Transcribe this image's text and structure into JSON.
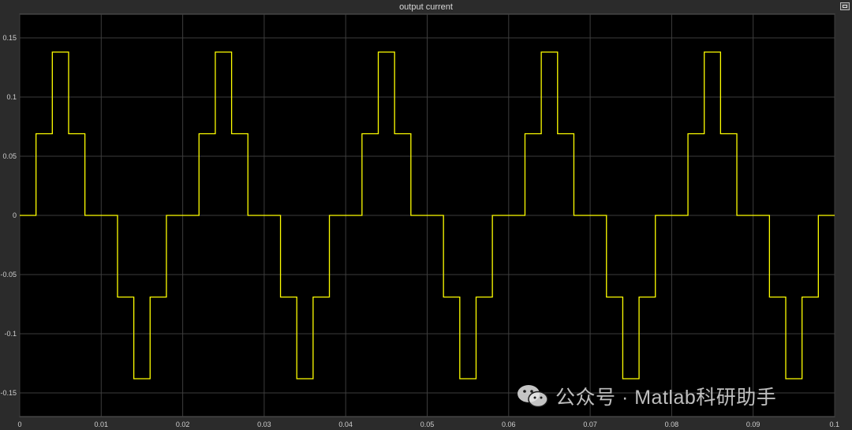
{
  "chart_data": {
    "type": "line",
    "title": "output current",
    "xlim": [
      0,
      0.1
    ],
    "ylim": [
      -0.17,
      0.17
    ],
    "x_ticks": [
      0,
      0.01,
      0.02,
      0.03,
      0.04,
      0.05,
      0.06,
      0.07,
      0.08,
      0.09,
      0.1
    ],
    "x_tick_labels": [
      "0",
      "0.01",
      "0.02",
      "0.03",
      "0.04",
      "0.05",
      "0.06",
      "0.07",
      "0.08",
      "0.09",
      "0.1"
    ],
    "y_ticks": [
      -0.15,
      -0.1,
      -0.05,
      0,
      0.05,
      0.1,
      0.15
    ],
    "y_tick_labels": [
      "-0.15",
      "-0.1",
      "-0.05",
      "0",
      "0.05",
      "0.1",
      "0.15"
    ],
    "grid": true,
    "background": "#000000",
    "line_color": "#ffff00",
    "series": [
      {
        "step": "post",
        "x": [
          0,
          0.002,
          0.004,
          0.006,
          0.008,
          0.012,
          0.014,
          0.016,
          0.018,
          0.022,
          0.024,
          0.026,
          0.028,
          0.032,
          0.034,
          0.036,
          0.038,
          0.042,
          0.044,
          0.046,
          0.048,
          0.052,
          0.054,
          0.056,
          0.058,
          0.062,
          0.064,
          0.066,
          0.068,
          0.072,
          0.074,
          0.076,
          0.078,
          0.082,
          0.084,
          0.086,
          0.088,
          0.092,
          0.094,
          0.096,
          0.098,
          0.1
        ],
        "y": [
          0,
          0.069,
          0.138,
          0.069,
          0,
          -0.069,
          -0.138,
          -0.069,
          0,
          0.069,
          0.138,
          0.069,
          0,
          -0.069,
          -0.138,
          -0.069,
          0,
          0.069,
          0.138,
          0.069,
          0,
          -0.069,
          -0.138,
          -0.069,
          0,
          0.069,
          0.138,
          0.069,
          0,
          -0.069,
          -0.138,
          -0.069,
          0,
          0.069,
          0.138,
          0.069,
          0,
          -0.069,
          -0.138,
          -0.069,
          0,
          0
        ]
      }
    ]
  },
  "watermark": {
    "text": "公众号 · Matlab科研助手",
    "icon": "wechat-icon"
  },
  "window": {
    "restore_icon": "restore-icon"
  }
}
